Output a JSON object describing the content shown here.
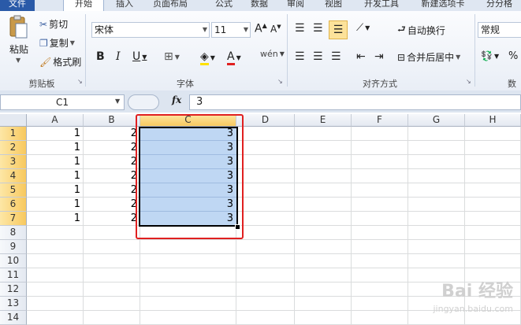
{
  "tabs": [
    "文件",
    "开始",
    "插入",
    "页面布局",
    "公式",
    "数据",
    "审阅",
    "视图",
    "开发工具",
    "新建选项卡",
    "分分格"
  ],
  "clipboard": {
    "paste": "粘贴",
    "cut": "剪切",
    "copy": "复制",
    "format_painter": "格式刷",
    "label": "剪贴板"
  },
  "font": {
    "name": "宋体",
    "size": "11",
    "label": "字体"
  },
  "alignment": {
    "wrap": "自动换行",
    "merge": "合并后居中",
    "label": "对齐方式"
  },
  "number": {
    "format": "常规",
    "label": "数"
  },
  "namebox": "C1",
  "fx_label": "fx",
  "formula": "3",
  "columns": [
    "A",
    "B",
    "C",
    "D",
    "E",
    "F",
    "G",
    "H"
  ],
  "rows": [
    "1",
    "2",
    "3",
    "4",
    "5",
    "6",
    "7",
    "8",
    "9",
    "10",
    "11",
    "12",
    "13",
    "14"
  ],
  "values": {
    "A": [
      "1",
      "1",
      "1",
      "1",
      "1",
      "1",
      "1"
    ],
    "B": [
      "2",
      "2",
      "2",
      "2",
      "2",
      "2",
      "2"
    ],
    "C": [
      "3",
      "3",
      "3",
      "3",
      "3",
      "3",
      "3"
    ]
  },
  "watermark": {
    "brand": "Bai 经验",
    "url": "jingyan.baidu.com"
  },
  "colors": {
    "selection": "#bfd7f3",
    "highlight_box": "#e02020",
    "active_header": "#f8c95f"
  }
}
